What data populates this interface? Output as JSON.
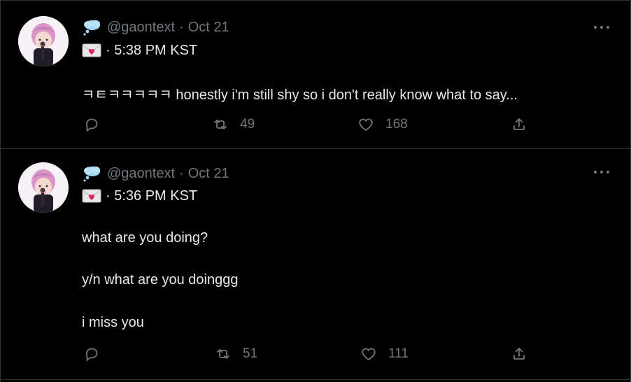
{
  "tweets": [
    {
      "handle": "@gaontext",
      "date_sep": "·",
      "date": "Oct 21",
      "time_line": "· 5:38 PM KST",
      "lines": [
        "ㅋㅌㅋㅋㅋㅋㅋ honestly i'm still shy so i don't really know what to say..."
      ],
      "retweets": "49",
      "likes": "168"
    },
    {
      "handle": "@gaontext",
      "date_sep": "·",
      "date": "Oct 21",
      "time_line": "· 5:36 PM KST",
      "lines": [
        "what are you doing?",
        "y/n what are you doinggg",
        "i miss you"
      ],
      "retweets": "51",
      "likes": "111"
    }
  ],
  "icons": {
    "cloud": "thought-balloon-emoji",
    "envelope": "love-letter-emoji",
    "reply": "reply-icon",
    "retweet": "retweet-icon",
    "like": "heart-icon",
    "share": "share-icon",
    "more": "more-dots-icon"
  },
  "colors": {
    "background": "#000000",
    "text": "#e7e9ea",
    "muted": "#71767b",
    "divider": "#2f3336"
  }
}
